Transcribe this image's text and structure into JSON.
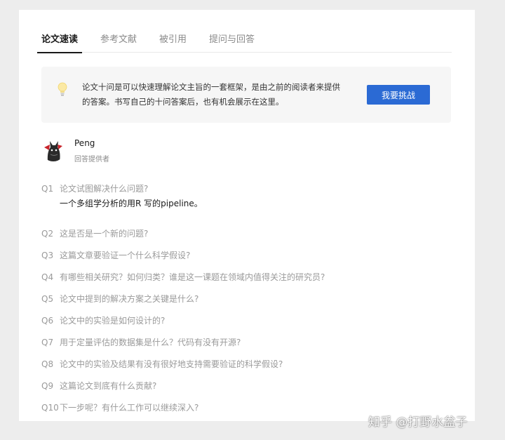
{
  "tabs": [
    {
      "label": "论文速读",
      "active": true
    },
    {
      "label": "参考文献",
      "active": false
    },
    {
      "label": "被引用",
      "active": false
    },
    {
      "label": "提问与回答",
      "active": false
    }
  ],
  "banner": {
    "icon": "lightbulb-icon",
    "line1": "论文十问是可以快速理解论文主旨的一套框架，是由之前的阅读者来提供",
    "line2": "的答案。书写自己的十问答案后，也有机会展示在这里。",
    "button_label": "我要挑战",
    "button_color": "#2b6ad4"
  },
  "author": {
    "name": "Peng",
    "role": "回答提供者"
  },
  "questions": [
    {
      "num": "Q1",
      "text": "论文试图解决什么问题?",
      "answer": "一个多组学分析的用R 写的pipeline。"
    },
    {
      "num": "Q2",
      "text": "这是否是一个新的问题?"
    },
    {
      "num": "Q3",
      "text": "这篇文章要验证一个什么科学假设?"
    },
    {
      "num": "Q4",
      "text": "有哪些相关研究？如何归类？谁是这一课题在领域内值得关注的研究员?"
    },
    {
      "num": "Q5",
      "text": "论文中提到的解决方案之关键是什么?"
    },
    {
      "num": "Q6",
      "text": "论文中的实验是如何设计的?"
    },
    {
      "num": "Q7",
      "text": "用于定量评估的数据集是什么？代码有没有开源?"
    },
    {
      "num": "Q8",
      "text": "论文中的实验及结果有没有很好地支持需要验证的科学假设?"
    },
    {
      "num": "Q9",
      "text": "这篇论文到底有什么贡献?"
    },
    {
      "num": "Q10",
      "text": "下一步呢？有什么工作可以继续深入?"
    }
  ],
  "watermark": "知乎 @打野水盆子"
}
